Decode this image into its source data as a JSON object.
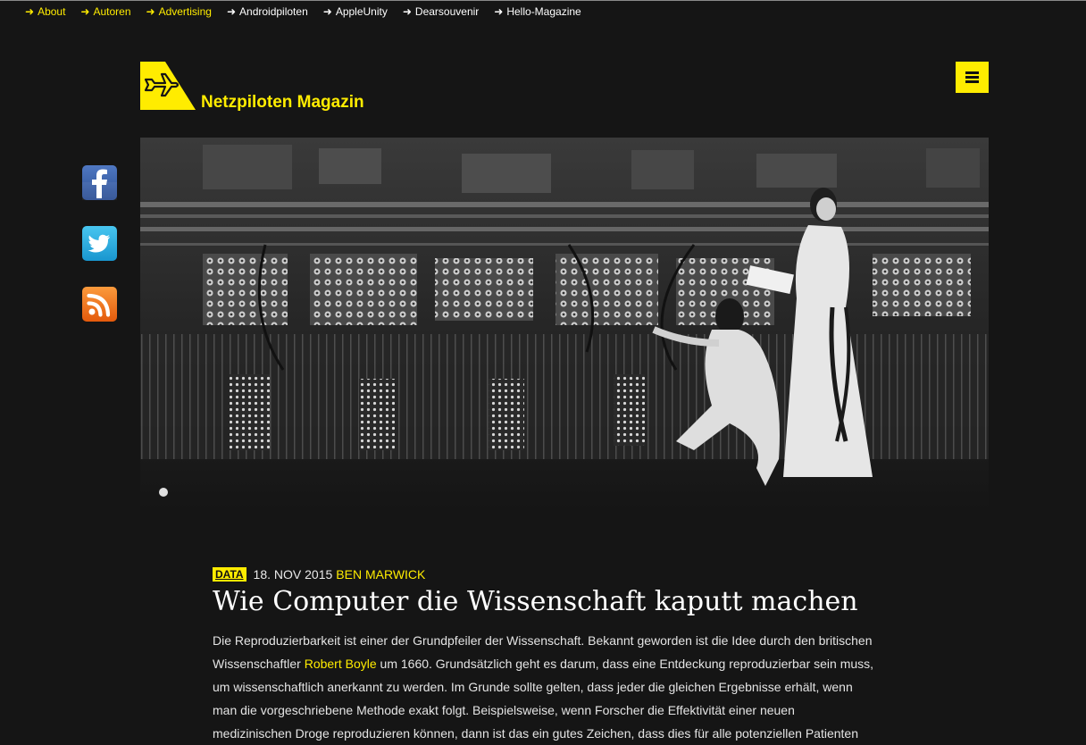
{
  "topnav": [
    {
      "label": "About",
      "arrow": "➜",
      "highlight": true
    },
    {
      "label": "Autoren",
      "arrow": "➜",
      "highlight": true
    },
    {
      "label": "Advertising",
      "arrow": "➜",
      "highlight": true
    },
    {
      "label": "Androidpiloten",
      "arrow": "➜",
      "highlight": false
    },
    {
      "label": "AppleUnity",
      "arrow": "➜",
      "highlight": false
    },
    {
      "label": "Dearsouvenir",
      "arrow": "➜",
      "highlight": false
    },
    {
      "label": "Hello-Magazine",
      "arrow": "➜",
      "highlight": false
    }
  ],
  "brand": {
    "name": "Netzpiloten Magazin",
    "accent": "#ffec00",
    "background": "#151515"
  },
  "menu": {
    "icon": "hamburger-icon"
  },
  "social": [
    {
      "name": "facebook",
      "glyph": "f",
      "color": "#3b5998"
    },
    {
      "name": "twitter",
      "glyph": "bird",
      "color": "#29aae1"
    },
    {
      "name": "rss",
      "glyph": "rss",
      "color": "#f37a21"
    }
  ],
  "hero": {
    "icon": "eniac-photo"
  },
  "article": {
    "category": "DATA",
    "date": "18. NOV 2015",
    "author": "BEN MARWICK",
    "title": "Wie Computer die Wissenschaft kaputt machen",
    "p1": {
      "line1": "Die Reproduzierbarkeit ist einer der Grundpfeiler der Wissenschaft. Bekannt geworden ist die Idee durch den britischen",
      "line2_before": "Wissenschaftler ",
      "line2_link": "Robert Boyle",
      "line2_after": " um 1660. Grundsätzlich geht es darum, dass eine Entdeckung reproduzierbar sein muss,",
      "line3": "um wissenschaftlich anerkannt zu werden. Im Grunde sollte gelten, dass jeder die gleichen Ergebnisse erhält, wenn",
      "line4": "man die vorgeschriebene Methode exakt folgt. Beispielsweise, wenn Forscher die Effektivität einer neuen",
      "line5": "medizinischen Droge reproduzieren können, dann ist das ein gutes Zeichen, dass dies für alle potenziellen Patienten"
    }
  }
}
